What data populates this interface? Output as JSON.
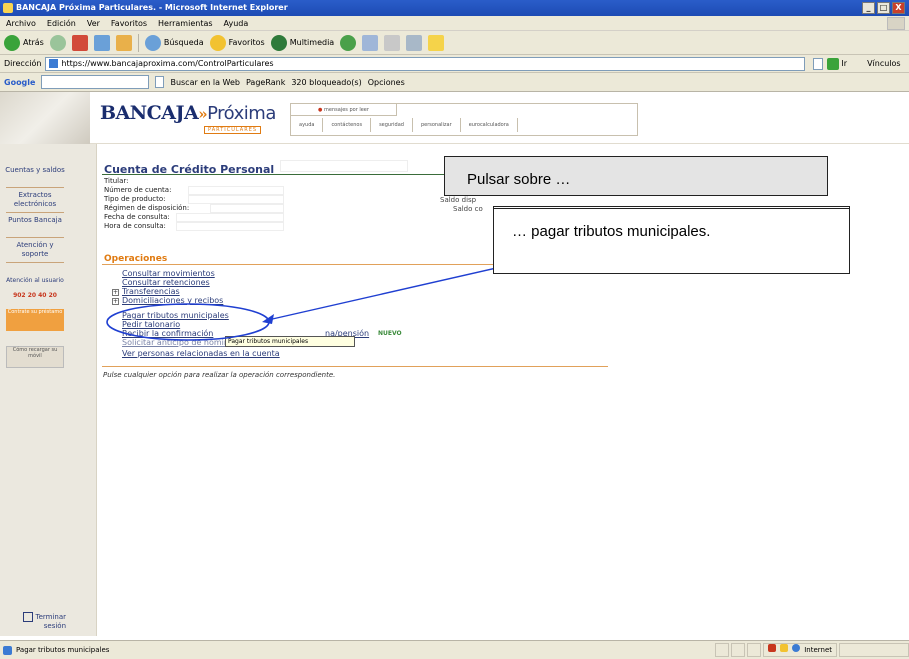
{
  "window": {
    "title": "BANCAJA Próxima Particulares. - Microsoft Internet Explorer",
    "controls": [
      "_",
      "□",
      "X"
    ]
  },
  "menu": [
    "Archivo",
    "Edición",
    "Ver",
    "Favoritos",
    "Herramientas",
    "Ayuda"
  ],
  "toolbar": {
    "back": "Atrás",
    "search": "Búsqueda",
    "favorites": "Favoritos",
    "multimedia": "Multimedia"
  },
  "address": {
    "label": "Dirección",
    "url": "https://www.bancajaproxima.com/ControlParticulares",
    "go": "Ir",
    "links": "Vínculos"
  },
  "googlebar": {
    "brand": "Google",
    "search_web": "Buscar en la Web",
    "pagerank": "PageRank",
    "blocked": "320 bloqueado(s)",
    "options": "Opciones"
  },
  "bank": {
    "logo_main": "BANCAJA",
    "logo_arrows": "»",
    "logo_proxima": "Próxima",
    "logo_sub": "PARTICULARES",
    "messages": "mensajes por leer",
    "nav": [
      "ayuda",
      "contáctenos",
      "seguridad",
      "personalizar",
      "eurocalculadora"
    ]
  },
  "sidebar": {
    "items": [
      "Cuentas y saldos",
      "Extractos electrónicos",
      "Puntos Bancaja",
      "Atención y soporte"
    ],
    "support": "Atención al usuario",
    "phone": "902 20 40 20",
    "btn_orange": "Contrate su préstamo",
    "btn_gray": "Cómo recargar su móvil",
    "logout": "Terminar sesión"
  },
  "account": {
    "title": "Cuenta de Crédito Personal",
    "fields": [
      "Titular:",
      "Número de cuenta:",
      "Tipo de producto:",
      "Régimen de disposición:",
      "Fecha de consulta:",
      "Hora de consulta:"
    ],
    "saldo_disp": "Saldo disp",
    "saldo": "Saldo co"
  },
  "operations": {
    "title": "Operaciones",
    "links": [
      "Consultar movimientos",
      "Consultar retenciones",
      "Transferencias",
      "Domiciliaciones y recibos",
      "Pagar tributos municipales",
      "Pedir talonario",
      "Recibir la confirmación",
      "Solicitar anticipo de nómina/pensión",
      "Ver personas relacionadas en la cuenta"
    ],
    "link_extra": "na/pensión",
    "new_tag": "NUEVO",
    "hint": "Pulse cualquier opción para realizar la operación correspondiente."
  },
  "tooltip": "Pagar tributos municipales",
  "callouts": {
    "first": "Pulsar sobre …",
    "second": "… pagar tributos municipales."
  },
  "status": {
    "text": "Pagar tributos municipales",
    "zone": "Internet"
  }
}
